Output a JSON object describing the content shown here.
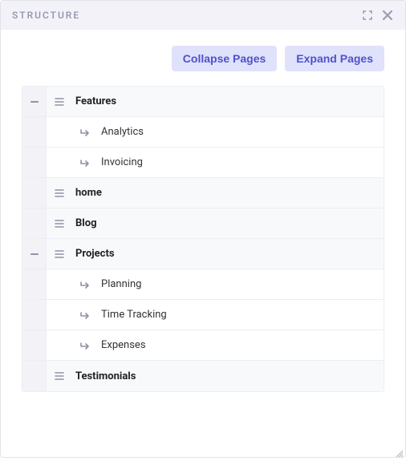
{
  "header": {
    "title": "STRUCTURE"
  },
  "toolbar": {
    "collapse_label": "Collapse Pages",
    "expand_label": "Expand Pages"
  },
  "tree": {
    "items": [
      {
        "label": "Features",
        "level": 0,
        "bold": true,
        "caret": true
      },
      {
        "label": "Analytics",
        "level": 1,
        "bold": false,
        "caret": false
      },
      {
        "label": "Invoicing",
        "level": 1,
        "bold": false,
        "caret": false
      },
      {
        "label": "home",
        "level": 0,
        "bold": true,
        "caret": false
      },
      {
        "label": "Blog",
        "level": 0,
        "bold": true,
        "caret": false
      },
      {
        "label": "Projects",
        "level": 0,
        "bold": true,
        "caret": true
      },
      {
        "label": "Planning",
        "level": 1,
        "bold": false,
        "caret": false
      },
      {
        "label": "Time Tracking",
        "level": 1,
        "bold": false,
        "caret": false
      },
      {
        "label": "Expenses",
        "level": 1,
        "bold": false,
        "caret": false
      },
      {
        "label": "Testimonials",
        "level": 0,
        "bold": true,
        "caret": false
      }
    ]
  }
}
